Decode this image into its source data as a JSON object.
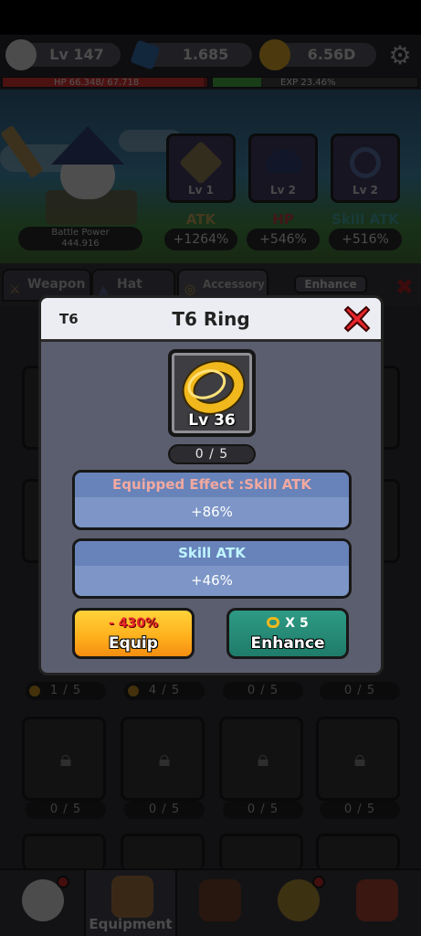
{
  "hud": {
    "level": "Lv 147",
    "gems": "1.685",
    "gold": "6.56D",
    "hp_text": "HP  66.348/ 67.718",
    "hp_fraction": 0.98,
    "exp_text": "EXP  23.46%",
    "exp_fraction": 0.2346
  },
  "hero": {
    "battle_power_label": "Battle Power",
    "battle_power_value": "444.916",
    "stats": [
      {
        "lv": "Lv 1",
        "name": "ATK",
        "value": "+1264%",
        "color": "#7d6a3a"
      },
      {
        "lv": "Lv 2",
        "name": "HP",
        "value": "+546%",
        "color": "#7a2a28"
      },
      {
        "lv": "Lv 2",
        "name": "Skill ATK",
        "value": "+516%",
        "color": "#2f6a6a"
      }
    ]
  },
  "tabs": {
    "weapon": "Weapon",
    "hat": "Hat",
    "accessory": "Accessory",
    "enhance": "Enhance"
  },
  "grid": {
    "counts_row3": [
      "1 / 5",
      "4 / 5",
      "0 / 5",
      "0 / 5"
    ],
    "counts_row4": [
      "0 / 5",
      "0 / 5",
      "0 / 5",
      "0 / 5"
    ]
  },
  "nav": {
    "equipment_label": "Equipment"
  },
  "dialog": {
    "tier": "T6",
    "title": "T6 Ring",
    "item_level": "Lv 36",
    "progress": "0 / 5",
    "equipped_effect_title": "Equipped Effect :Skill ATK",
    "equipped_effect_value": "+86%",
    "stat_title": "Skill ATK",
    "stat_value": "+46%",
    "equip_delta": "- 430%",
    "equip_label": "Equip",
    "enhance_cost": "X 5",
    "enhance_label": "Enhance",
    "colors": {
      "panel": "#7d96c7",
      "panel_header": "#6883ba",
      "panel_header_text": "#f2a9a0",
      "equip_button": "#ffb21e",
      "enhance_button": "#1f7c6a"
    }
  }
}
